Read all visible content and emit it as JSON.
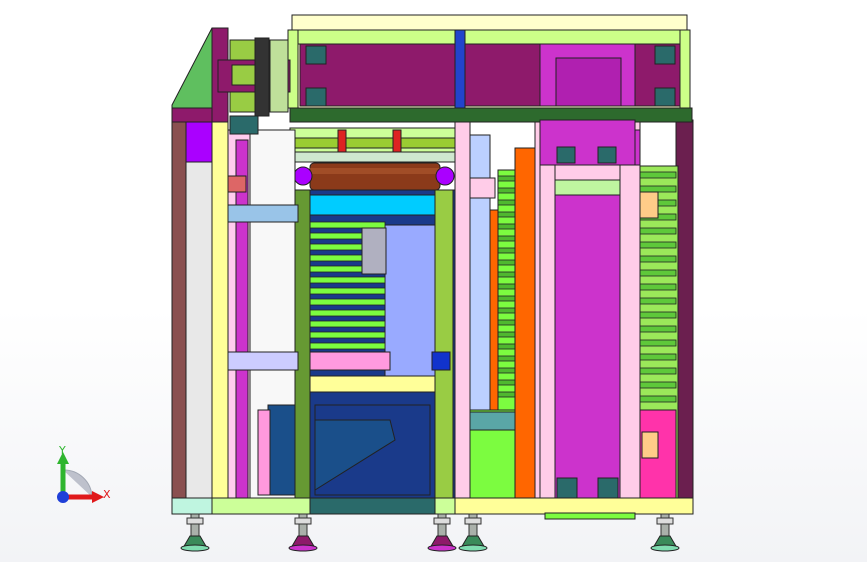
{
  "viewport": {
    "background": "#ffffff"
  },
  "triad": {
    "x_label": "X",
    "y_label": "Y",
    "x_color": "#e0191b",
    "y_color": "#2fb52f",
    "origin_color": "#1f3fd8"
  },
  "model": {
    "palette": {
      "dark_purple": "#8e1a6b",
      "magenta": "#cc33cc",
      "violet": "#aa00ff",
      "lime": "#7cfc40",
      "olive_green": "#99cc44",
      "cream": "#ffff99",
      "light_pink": "#ffcce8",
      "hot_pink": "#ff33aa",
      "cyan": "#00ccff",
      "light_blue": "#99aaff",
      "navy": "#1a3a8a",
      "orange": "#ff6600",
      "brown_roller": "#8b3a1a",
      "teal_block": "#2a6a6a",
      "dark_green": "#2d6a2d",
      "mauve": "#7a4a5a",
      "gray": "#888888"
    }
  }
}
